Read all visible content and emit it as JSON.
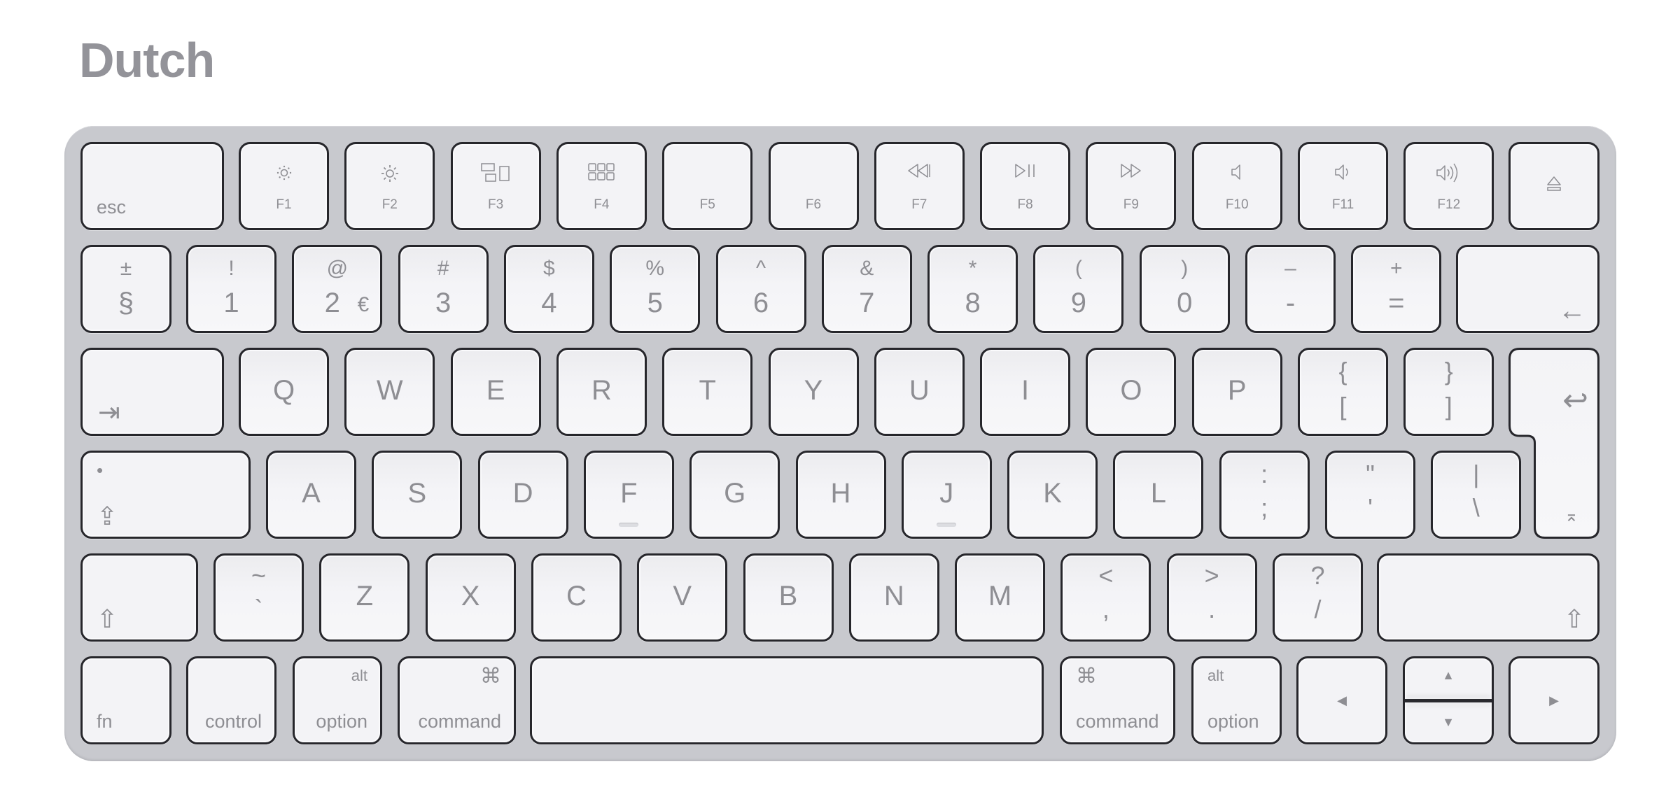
{
  "title": "Dutch",
  "keyboard": {
    "row1": {
      "esc": "esc",
      "fkeys": [
        {
          "label": "F1",
          "icon": "brightness-down-icon"
        },
        {
          "label": "F2",
          "icon": "brightness-up-icon"
        },
        {
          "label": "F3",
          "icon": "mission-control-icon"
        },
        {
          "label": "F4",
          "icon": "launchpad-icon"
        },
        {
          "label": "F5",
          "icon": ""
        },
        {
          "label": "F6",
          "icon": ""
        },
        {
          "label": "F7",
          "icon": "rewind-icon"
        },
        {
          "label": "F8",
          "icon": "play-pause-icon"
        },
        {
          "label": "F9",
          "icon": "fast-forward-icon"
        },
        {
          "label": "F10",
          "icon": "mute-icon"
        },
        {
          "label": "F11",
          "icon": "volume-down-icon"
        },
        {
          "label": "F12",
          "icon": "volume-up-icon"
        }
      ],
      "eject": "⏏"
    },
    "row2": {
      "keys": [
        {
          "top": "±",
          "bottom": "§"
        },
        {
          "top": "!",
          "bottom": "1"
        },
        {
          "top": "@",
          "bottom": "2",
          "extra": "€"
        },
        {
          "top": "#",
          "bottom": "3"
        },
        {
          "top": "$",
          "bottom": "4"
        },
        {
          "top": "%",
          "bottom": "5"
        },
        {
          "top": "^",
          "bottom": "6"
        },
        {
          "top": "&",
          "bottom": "7"
        },
        {
          "top": "*",
          "bottom": "8"
        },
        {
          "top": "(",
          "bottom": "9"
        },
        {
          "top": ")",
          "bottom": "0"
        },
        {
          "top": "–",
          "bottom": "-"
        },
        {
          "top": "+",
          "bottom": "="
        }
      ],
      "delete": "←"
    },
    "row3": {
      "tab": "⇥",
      "keys": [
        {
          "label": "Q"
        },
        {
          "label": "W"
        },
        {
          "label": "E"
        },
        {
          "label": "R"
        },
        {
          "label": "T"
        },
        {
          "label": "Y"
        },
        {
          "label": "U"
        },
        {
          "label": "I"
        },
        {
          "label": "O"
        },
        {
          "label": "P"
        },
        {
          "top": "{",
          "bottom": "["
        },
        {
          "top": "}",
          "bottom": "]"
        }
      ],
      "return": "↩",
      "return_lower": "⌅"
    },
    "row4": {
      "caps_dot": "•",
      "caps": "⇪",
      "keys": [
        {
          "label": "A"
        },
        {
          "label": "S"
        },
        {
          "label": "D"
        },
        {
          "label": "F",
          "bump": true
        },
        {
          "label": "G"
        },
        {
          "label": "H"
        },
        {
          "label": "J",
          "bump": true
        },
        {
          "label": "K"
        },
        {
          "label": "L"
        },
        {
          "top": ":",
          "bottom": ";"
        },
        {
          "top": "\"",
          "bottom": "'"
        },
        {
          "top": "|",
          "bottom": "\\"
        }
      ]
    },
    "row5": {
      "left_shift": "⇧",
      "keys": [
        {
          "top": "~",
          "bottom": "`"
        },
        {
          "label": "Z"
        },
        {
          "label": "X"
        },
        {
          "label": "C"
        },
        {
          "label": "V"
        },
        {
          "label": "B"
        },
        {
          "label": "N"
        },
        {
          "label": "M"
        },
        {
          "top": "<",
          "bottom": ","
        },
        {
          "top": ">",
          "bottom": "."
        },
        {
          "top": "?",
          "bottom": "/"
        }
      ],
      "right_shift": "⇧"
    },
    "row6": {
      "fn": "fn",
      "control": "control",
      "option_left": {
        "top": "alt",
        "bottom": "option"
      },
      "command_left": {
        "top": "⌘",
        "bottom": "command"
      },
      "space": "",
      "command_right": {
        "top": "⌘",
        "bottom": "command"
      },
      "option_right": {
        "top": "alt",
        "bottom": "option"
      },
      "arrow_left": "◀",
      "arrow_up": "▲",
      "arrow_down": "▼",
      "arrow_right": "▶"
    }
  },
  "colors": {
    "chassis": "#c8c9ce",
    "key_face": "#f4f4f7",
    "key_border": "#26262b",
    "legend": "#8e8e93",
    "title": "#939399"
  }
}
